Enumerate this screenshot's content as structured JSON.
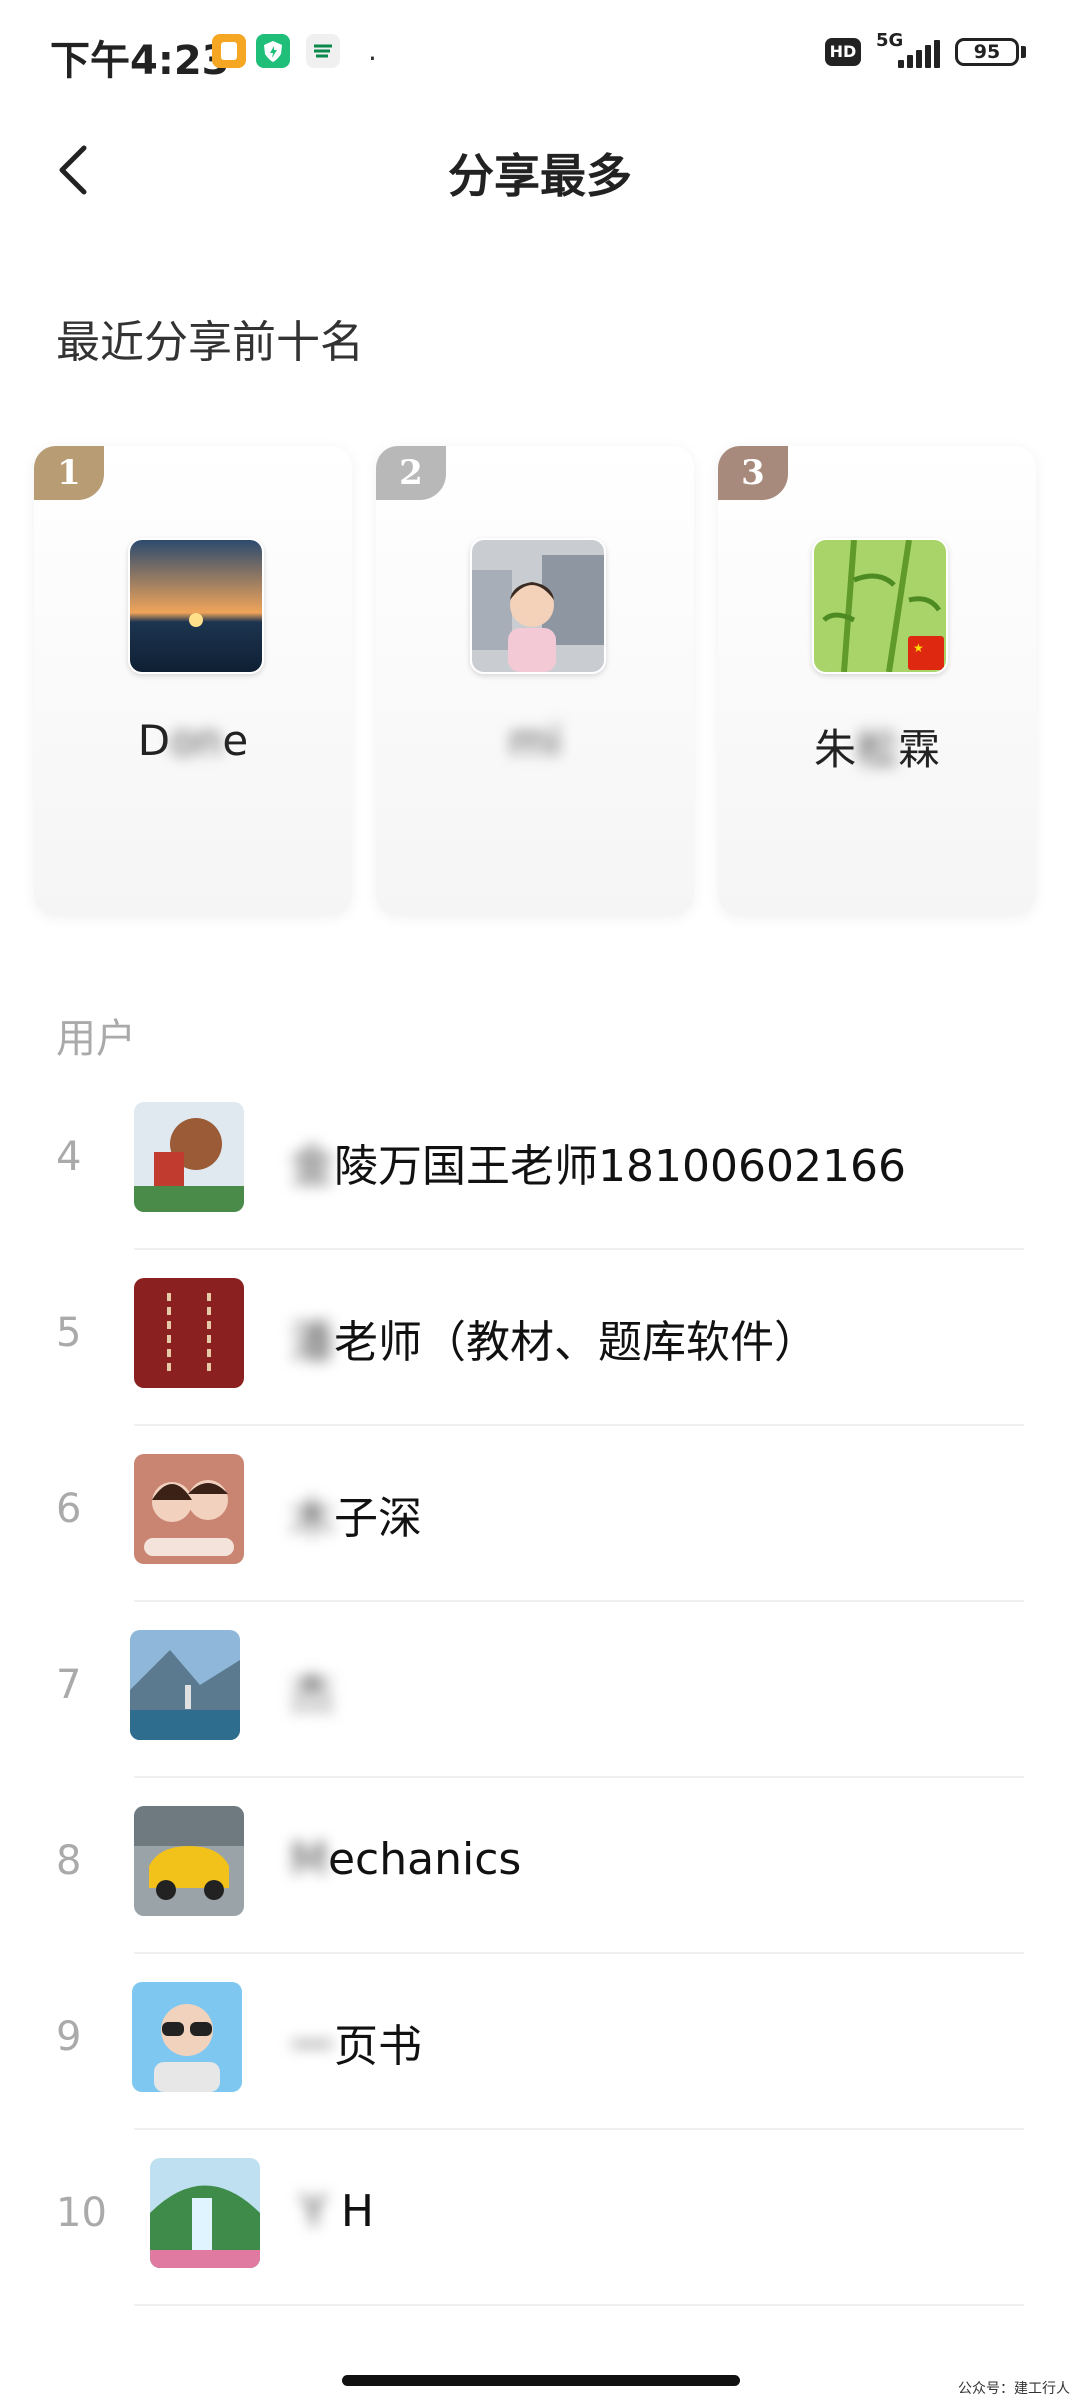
{
  "status_bar": {
    "time": "下午4:23",
    "network": "5G",
    "hd": "HD",
    "battery": "95",
    "dot": "·"
  },
  "header": {
    "title": "分享最多"
  },
  "section_title": "最近分享前十名",
  "top_cards": [
    {
      "rank": "1",
      "name_a": "D",
      "name_b": "on",
      "name_c": "e",
      "tag_color": "#b89c74"
    },
    {
      "rank": "2",
      "name_a": "",
      "name_b": "mi",
      "name_c": "",
      "tag_color": "#b8b8b8"
    },
    {
      "rank": "3",
      "name_a": "朱",
      "name_b": "松",
      "name_c": "霖",
      "tag_color": "#a88a7c"
    }
  ],
  "users_label": "用户",
  "rows": [
    {
      "rank": "4",
      "hidden": "金",
      "name": "陵万国王老师18100602166"
    },
    {
      "rank": "5",
      "hidden": "潘",
      "name": "老师（教材、题库软件）"
    },
    {
      "rank": "6",
      "hidden": "木",
      "name": "子深"
    },
    {
      "rank": "7",
      "hidden": "杰",
      "name": ""
    },
    {
      "rank": "8",
      "hidden": "M",
      "name": "echanics"
    },
    {
      "rank": "9",
      "hidden": "一",
      "name": "页书"
    },
    {
      "rank": "10",
      "hidden": "Y",
      "name": " H"
    }
  ],
  "watermark": "公众号：建工行人"
}
